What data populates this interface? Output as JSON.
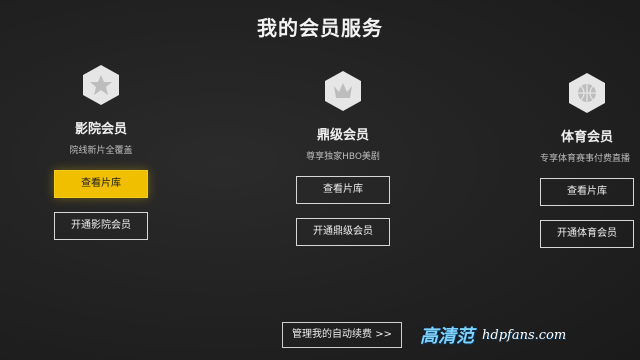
{
  "page": {
    "title": "我的会员服务"
  },
  "cards": [
    {
      "icon": "star-icon",
      "name": "影院会员",
      "desc": "院线新片全覆盖",
      "primary_button": "查看片库",
      "secondary_button": "开通影院会员"
    },
    {
      "icon": "crown-icon",
      "name": "鼎级会员",
      "desc": "尊享独家HBO美剧",
      "primary_button": "查看片库",
      "secondary_button": "开通鼎级会员"
    },
    {
      "icon": "basketball-icon",
      "name": "体育会员",
      "desc": "专享体育赛事付费直播",
      "primary_button": "查看片库",
      "secondary_button": "开通体育会员"
    }
  ],
  "footer": {
    "manage_label": "管理我的自动续费 >>"
  },
  "watermark": {
    "cn": "高清范",
    "en": "hdpfans.com"
  },
  "colors": {
    "background": "#1c1c1c",
    "accent": "#f0c000",
    "text": "#e9e9e9"
  }
}
